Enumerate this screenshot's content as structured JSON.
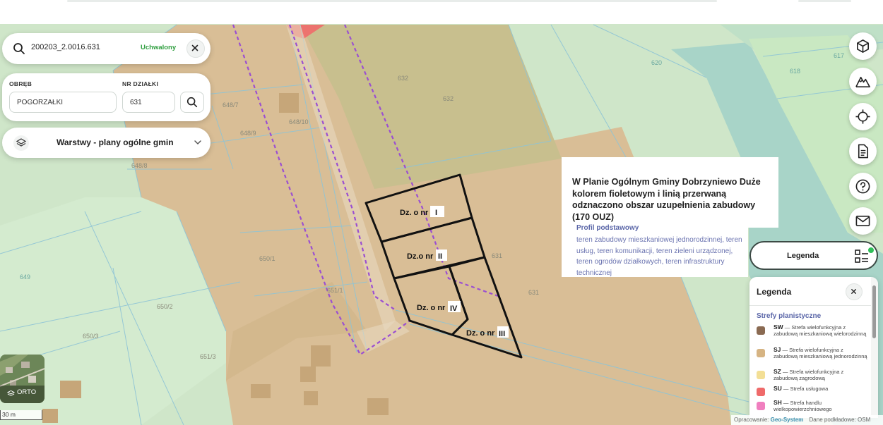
{
  "search": {
    "query": "200203_2.0016.631",
    "status": "Uchwalony"
  },
  "parcel_form": {
    "obreb_label": "OBRĘB",
    "obreb_value": "POGORZAŁKI",
    "nr_label": "NR DZIAŁKI",
    "nr_value": "631"
  },
  "layers": {
    "label": "Warstwy - plany ogólne gmin"
  },
  "right_toolbar": {
    "buttons": [
      "cube-icon",
      "terrain-icon",
      "locate-icon",
      "document-icon",
      "help-icon",
      "mail-icon"
    ]
  },
  "info": {
    "text": "W Planie Ogólnym Gminy Dobrzyniewo Duże kolorem fioletowym i linią przerwaną odznaczono obszar uzupełnienia zabudowy (170 OUZ)",
    "profile_title": "Profil podstawowy",
    "profile_text": "teren zabudowy mieszkaniowej jednorodzinnej, teren usług, teren komunikacji, teren zieleni urządzonej, teren ogrodów działkowych, teren infrastruktury technicznej"
  },
  "legend_button": {
    "label": "Legenda"
  },
  "legend": {
    "title": "Legenda",
    "section": "Strefy planistyczne",
    "items": [
      {
        "code": "SW",
        "text": "— Strefa wielofunkcyjna z zabudową mieszkaniową wielorodzinną",
        "color": "#8a6a52"
      },
      {
        "code": "SJ",
        "text": "— Strefa wielofunkcyjna z zabudową mieszkaniową jednorodzinną",
        "color": "#d6b483"
      },
      {
        "code": "SZ",
        "text": "— Strefa wielofunkcyjna z zabudową zagrodową",
        "color": "#f3df96"
      },
      {
        "code": "SU",
        "text": "— Strefa usługowa",
        "color": "#ef6a6a"
      },
      {
        "code": "SH",
        "text": "— Strefa handlu wielkopowierzchniowego",
        "color": "#f07fbf"
      }
    ]
  },
  "map": {
    "parcel_labels": [
      "648/7",
      "648/9",
      "648/10",
      "648/8",
      "632",
      "632",
      "620",
      "617",
      "618",
      "631",
      "631",
      "650/1",
      "651/1",
      "650/2",
      "650/3",
      "651/3",
      "649"
    ],
    "plot_labels": [
      {
        "prefix": "Dz. o nr",
        "roman": "I"
      },
      {
        "prefix": "Dz.o nr",
        "roman": "II"
      },
      {
        "prefix": "Dz. o nr",
        "roman": "IV"
      },
      {
        "prefix": "Dz. o nr",
        "roman": "III"
      }
    ]
  },
  "orto": {
    "label": "ORTO"
  },
  "scale": {
    "label": "30 m"
  },
  "attribution": {
    "prefix": "Opracowanie:",
    "brand": "Geo-System",
    "suffix": "Dane podkładowe: OSM"
  },
  "colors": {
    "sj_zone": "#d9be96",
    "green_zone": "#cfe6c9",
    "teal_zone": "#a8d4c8",
    "olive_zone": "#c8bf8e",
    "ouz_line": "#9b4fd1",
    "accent_green": "#2f9e3f"
  }
}
